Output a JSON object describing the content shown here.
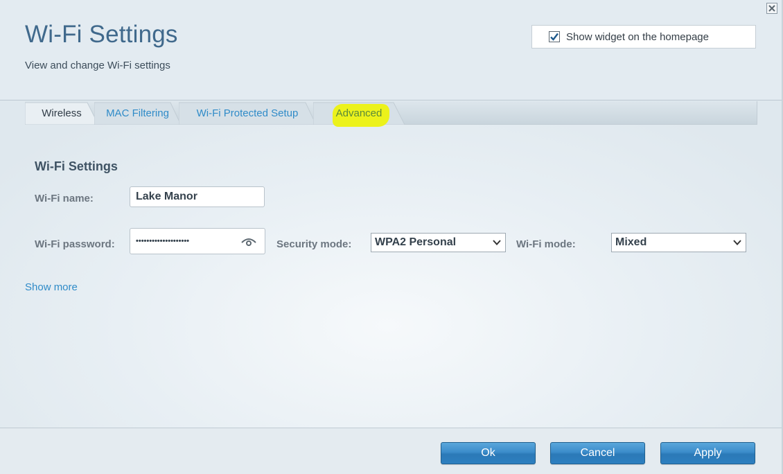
{
  "window": {
    "title": "Wi-Fi Settings",
    "subtitle": "View and change Wi-Fi settings",
    "close_icon": "close-icon"
  },
  "widget": {
    "checked": true,
    "label": "Show widget on the homepage"
  },
  "tabs": [
    {
      "label": "Wireless",
      "active": true
    },
    {
      "label": "MAC Filtering",
      "active": false
    },
    {
      "label": "Wi-Fi Protected Setup",
      "active": false
    },
    {
      "label": "Advanced",
      "active": false,
      "highlighted": true
    }
  ],
  "section": {
    "title": "Wi-Fi Settings",
    "wifi_name_label": "Wi-Fi name:",
    "wifi_name_value": "Lake Manor",
    "wifi_password_label": "Wi-Fi password:",
    "wifi_password_masked": "••••••••••••••••••••",
    "security_mode_label": "Security mode:",
    "security_mode_value": "WPA2 Personal",
    "wifi_mode_label": "Wi-Fi mode:",
    "wifi_mode_value": "Mixed",
    "show_more": "Show more"
  },
  "footer": {
    "ok_label": "Ok",
    "cancel_label": "Cancel",
    "apply_label": "Apply"
  },
  "colors": {
    "accent": "#2f8bc8",
    "title": "#40698c",
    "highlight": "#ecf21b",
    "button": "#3b8ccb"
  }
}
